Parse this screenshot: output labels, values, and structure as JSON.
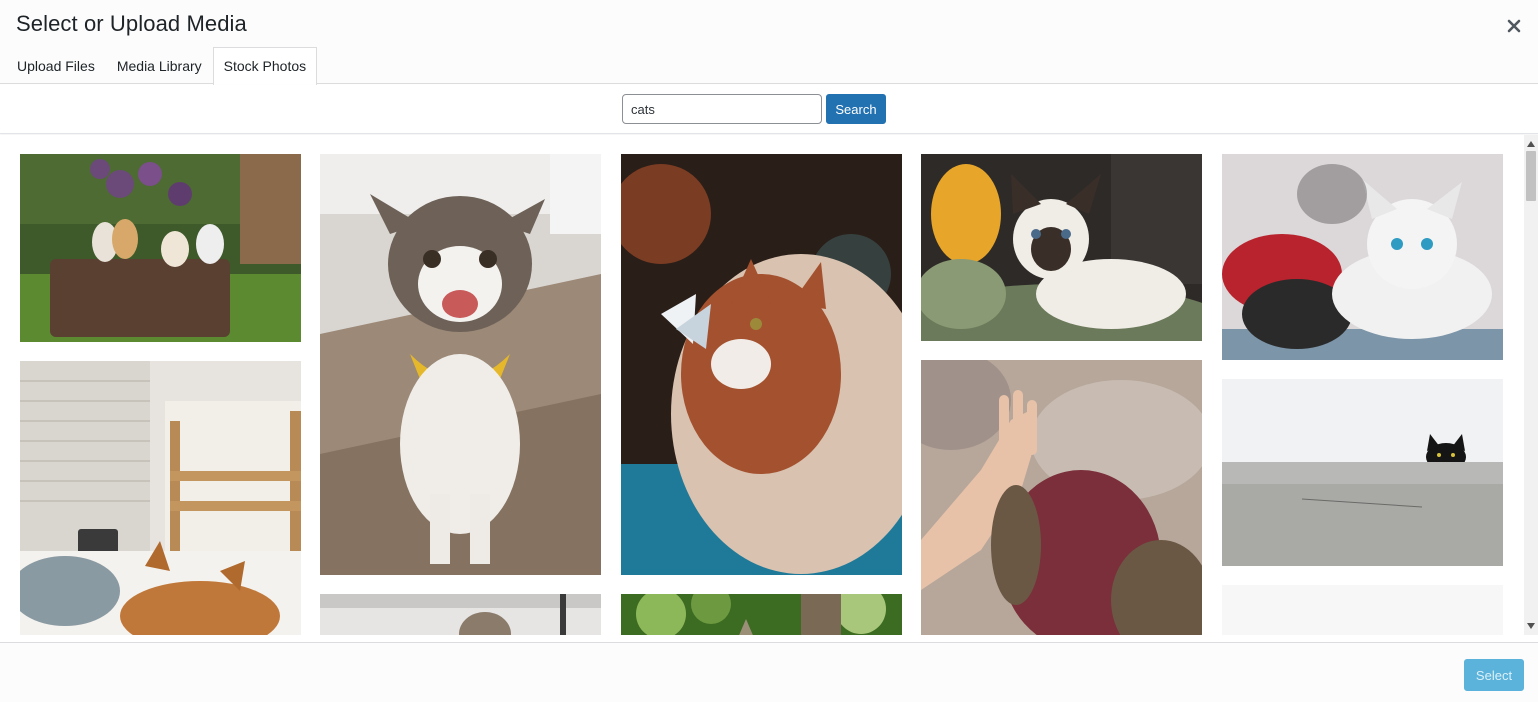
{
  "header": {
    "title": "Select or Upload Media"
  },
  "tabs": [
    {
      "label": "Upload Files",
      "active": false
    },
    {
      "label": "Media Library",
      "active": false
    },
    {
      "label": "Stock Photos",
      "active": true
    }
  ],
  "search": {
    "value": "cats",
    "button_label": "Search"
  },
  "photos": [
    {
      "subject": "kittens in a basket",
      "palette": [
        "#3e5a2a",
        "#6b4a7a",
        "#8a6e4c",
        "#e8e2d8"
      ]
    },
    {
      "subject": "cat sleeping by window",
      "palette": [
        "#e7e4df",
        "#c9a77a",
        "#b06a2d",
        "#f3f1ee"
      ]
    },
    {
      "subject": "smiling cat with yellow bandana",
      "palette": [
        "#d9d6d2",
        "#9c8977",
        "#6e6258",
        "#e5b82b"
      ]
    },
    {
      "subject": "cat partial bottom",
      "palette": [
        "#e6e5e3",
        "#8b7b6b"
      ]
    },
    {
      "subject": "cat with butterfly on nose",
      "palette": [
        "#2a1e18",
        "#a3512e",
        "#d9c2b0",
        "#1f7a99"
      ]
    },
    {
      "subject": "cat among greenery",
      "palette": [
        "#3c6b22",
        "#8db85a",
        "#9c8f78"
      ]
    },
    {
      "subject": "siamese kitten",
      "palette": [
        "#2d2a28",
        "#e7a52a",
        "#f0ece6",
        "#6b7a5a"
      ]
    },
    {
      "subject": "hand and cat paw high five",
      "palette": [
        "#b7a79b",
        "#e8c2a8",
        "#7a2f3a",
        "#6a5844"
      ]
    },
    {
      "subject": "two kittens black and white",
      "palette": [
        "#dcd8d9",
        "#b8232e",
        "#2a2a2a",
        "#f1f1f1"
      ]
    },
    {
      "subject": "black cat peeking over wall",
      "palette": [
        "#f1f2f4",
        "#b8b8b6",
        "#6a6a68",
        "#151515"
      ]
    },
    {
      "subject": "blank partial photo",
      "palette": [
        "#f7f7f7",
        "#efefef"
      ]
    }
  ],
  "footer": {
    "select_label": "Select"
  },
  "colors": {
    "primary": "#2271b1",
    "select_disabled": "#3fa7d6"
  },
  "icons": {
    "close": "close-icon",
    "scroll_up": "chevron-up-icon",
    "scroll_down": "chevron-down-icon"
  }
}
